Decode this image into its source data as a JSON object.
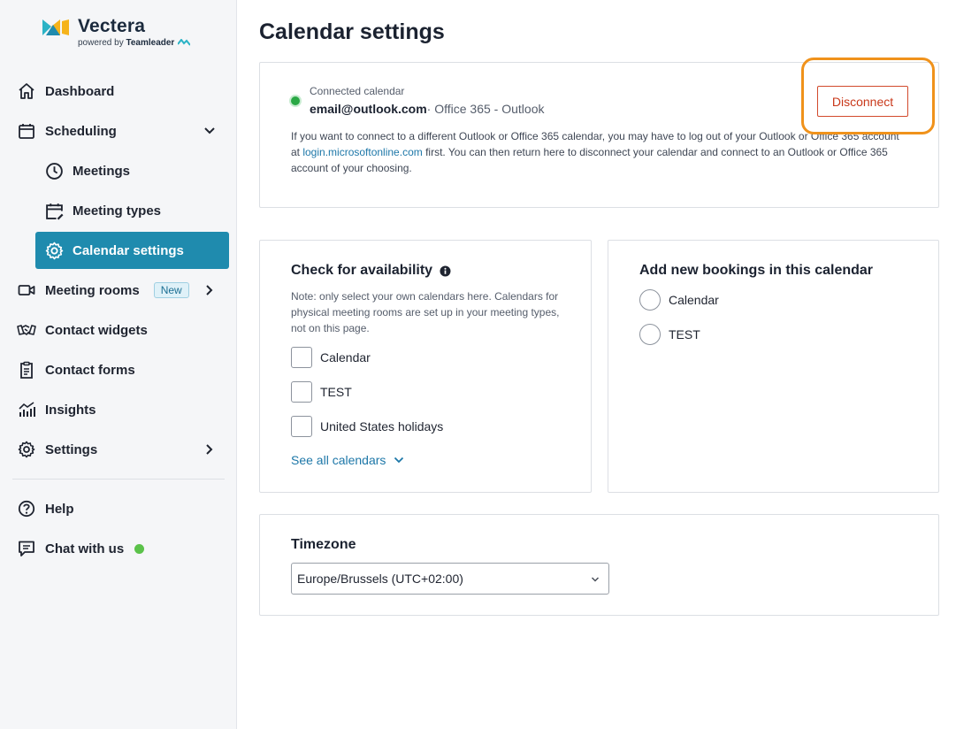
{
  "brand": {
    "name": "Vectera",
    "powered_by": "powered by",
    "partner": "Teamleader"
  },
  "sidebar": {
    "items": [
      {
        "label": "Dashboard"
      },
      {
        "label": "Scheduling"
      },
      {
        "label": "Meetings"
      },
      {
        "label": "Meeting types"
      },
      {
        "label": "Calendar settings"
      },
      {
        "label": "Meeting rooms",
        "badge": "New"
      },
      {
        "label": "Contact widgets"
      },
      {
        "label": "Contact forms"
      },
      {
        "label": "Insights"
      },
      {
        "label": "Settings"
      },
      {
        "label": "Help"
      },
      {
        "label": "Chat with us"
      }
    ],
    "active_item": "Calendar settings"
  },
  "page": {
    "title": "Calendar settings"
  },
  "connection": {
    "label": "Connected calendar",
    "email": "email@outlook.com",
    "provider": "· Office 365 - Outlook",
    "desc_pre": "If you want to connect to a different Outlook or Office 365 calendar, you may have to log out of your Outlook or Office 365 account at ",
    "desc_link": "login.microsoftonline.com",
    "desc_post": " first. You can then return here to disconnect your calendar and connect to an Outlook or Office 365 account of your choosing.",
    "disconnect_label": "Disconnect"
  },
  "availability": {
    "title": "Check for availability",
    "note": "Note: only select your own calendars here. Calendars for physical meeting rooms are set up in your meeting types, not on this page.",
    "calendars": [
      {
        "label": "Calendar",
        "checked": false
      },
      {
        "label": "TEST",
        "checked": false
      },
      {
        "label": "United States holidays",
        "checked": false
      }
    ],
    "see_all_label": "See all calendars"
  },
  "bookings": {
    "title": "Add new bookings in this calendar",
    "calendars": [
      {
        "label": "Calendar",
        "selected": false
      },
      {
        "label": "TEST",
        "selected": false
      }
    ]
  },
  "timezone": {
    "title": "Timezone",
    "value": "Europe/Brussels (UTC+02:00)"
  },
  "colors": {
    "accent": "#1f8bae",
    "danger": "#c9381a",
    "highlight": "#f0921b",
    "online": "#5bc24a"
  }
}
